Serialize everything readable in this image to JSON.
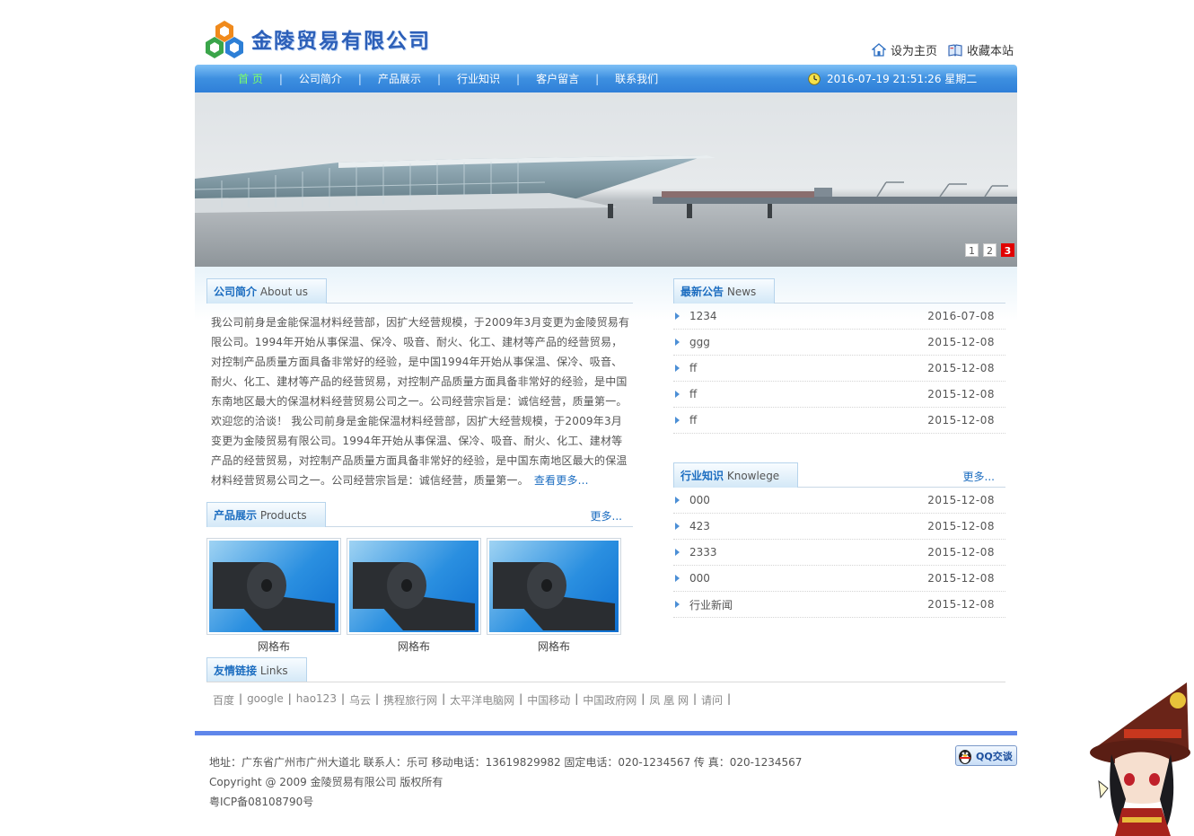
{
  "company_name": "金陵贸易有限公司",
  "top_links": {
    "home": "设为主页",
    "favorite": "收藏本站"
  },
  "nav": {
    "items": [
      "首 页",
      "公司简介",
      "产品展示",
      "行业知识",
      "客户留言",
      "联系我们"
    ],
    "separator": "|",
    "datetime": "2016-07-19 21:51:26 星期二"
  },
  "banner": {
    "pages": [
      "1",
      "2",
      "3"
    ],
    "active_page": "3"
  },
  "about": {
    "title": "公司简介",
    "subtitle": "About us",
    "text": "我公司前身是金能保温材料经营部，因扩大经营规模，于2009年3月变更为金陵贸易有限公司。1994年开始从事保温、保冷、吸音、耐火、化工、建材等产品的经营贸易，对控制产品质量方面具备非常好的经验，是中国1994年开始从事保温、保冷、吸音、耐火、化工、建材等产品的经营贸易，对控制产品质量方面具备非常好的经验，是中国东南地区最大的保温材料经营贸易公司之一。公司经营宗旨是：诚信经营，质量第一。欢迎您的洽谈！ 我公司前身是金能保温材料经营部，因扩大经营规模，于2009年3月变更为金陵贸易有限公司。1994年开始从事保温、保冷、吸音、耐火、化工、建材等产品的经营贸易，对控制产品质量方面具备非常好的经验，是中国东南地区最大的保温材料经营贸易公司之一。公司经营宗旨是：诚信经营，质量第一。",
    "more": "查看更多..."
  },
  "products": {
    "title": "产品展示",
    "subtitle": "Products",
    "more": "更多...",
    "items": [
      {
        "caption": "网格布"
      },
      {
        "caption": "网格布"
      },
      {
        "caption": "网格布"
      }
    ]
  },
  "news": {
    "title": "最新公告",
    "subtitle": "News",
    "items": [
      {
        "title": "1234",
        "date": "2016-07-08"
      },
      {
        "title": "ggg",
        "date": "2015-12-08"
      },
      {
        "title": "ff",
        "date": "2015-12-08"
      },
      {
        "title": "ff",
        "date": "2015-12-08"
      },
      {
        "title": "ff",
        "date": "2015-12-08"
      }
    ]
  },
  "knowledge": {
    "title": "行业知识",
    "subtitle": "Knowlege",
    "more": "更多...",
    "items": [
      {
        "title": "000",
        "date": "2015-12-08"
      },
      {
        "title": "423",
        "date": "2015-12-08"
      },
      {
        "title": "2333",
        "date": "2015-12-08"
      },
      {
        "title": "000",
        "date": "2015-12-08"
      },
      {
        "title": "行业新闻",
        "date": "2015-12-08"
      }
    ]
  },
  "links": {
    "title": "友情链接",
    "subtitle": "Links",
    "items": [
      "百度",
      "google",
      "hao123",
      "乌云",
      "携程旅行网",
      "太平洋电脑网",
      "中国移动",
      "中国政府网",
      "凤 凰 网",
      "请问"
    ],
    "separator": "|"
  },
  "footer": {
    "line1": "地址：广东省广州市广州大道北 联系人：乐可 移动电话：13619829982 固定电话：020-1234567 传 真：020-1234567",
    "line2": "Copyright @ 2009 金陵贸易有限公司 版权所有",
    "line3": "粤ICP备08108790号"
  },
  "qq_button": "QQ交谈",
  "colors": {
    "nav_blue": "#3d8fe0",
    "link_blue": "#1c6dc0",
    "footer_bar": "#5f86ea",
    "active_nav": "#7dff6a",
    "pager_active": "#e10000"
  }
}
